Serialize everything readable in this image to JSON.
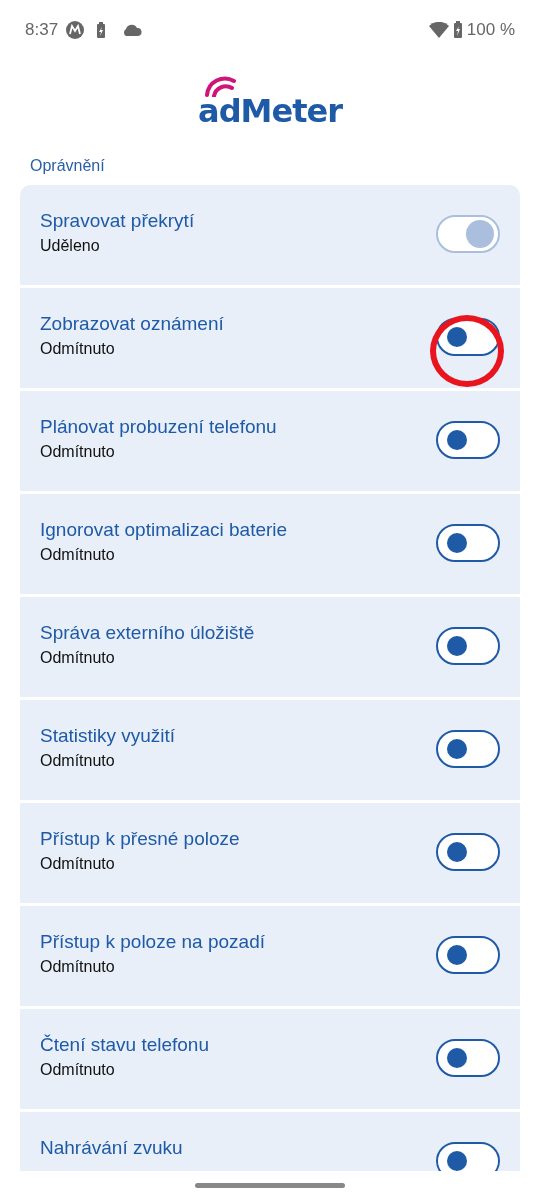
{
  "status_bar": {
    "time": "8:37",
    "battery": "100 %"
  },
  "logo": {
    "text": "adMeter"
  },
  "section": {
    "title": "Oprávnění"
  },
  "permissions": [
    {
      "title": "Spravovat překrytí",
      "subtitle": "Uděleno",
      "on": true,
      "disabled": true,
      "highlighted": false
    },
    {
      "title": "Zobrazovat oznámení",
      "subtitle": "Odmítnuto",
      "on": false,
      "disabled": false,
      "highlighted": true
    },
    {
      "title": "Plánovat probuzení telefonu",
      "subtitle": "Odmítnuto",
      "on": false,
      "disabled": false,
      "highlighted": false
    },
    {
      "title": "Ignorovat optimalizaci baterie",
      "subtitle": "Odmítnuto",
      "on": false,
      "disabled": false,
      "highlighted": false
    },
    {
      "title": "Správa externího úložiště",
      "subtitle": "Odmítnuto",
      "on": false,
      "disabled": false,
      "highlighted": false
    },
    {
      "title": "Statistiky využití",
      "subtitle": "Odmítnuto",
      "on": false,
      "disabled": false,
      "highlighted": false
    },
    {
      "title": "Přístup k přesné poloze",
      "subtitle": "Odmítnuto",
      "on": false,
      "disabled": false,
      "highlighted": false
    },
    {
      "title": "Přístup k poloze na pozadí",
      "subtitle": "Odmítnuto",
      "on": false,
      "disabled": false,
      "highlighted": false
    },
    {
      "title": "Čtení stavu telefonu",
      "subtitle": "Odmítnuto",
      "on": false,
      "disabled": false,
      "highlighted": false
    },
    {
      "title": "Nahrávání zvuku",
      "on": false,
      "disabled": false,
      "highlighted": false
    }
  ]
}
